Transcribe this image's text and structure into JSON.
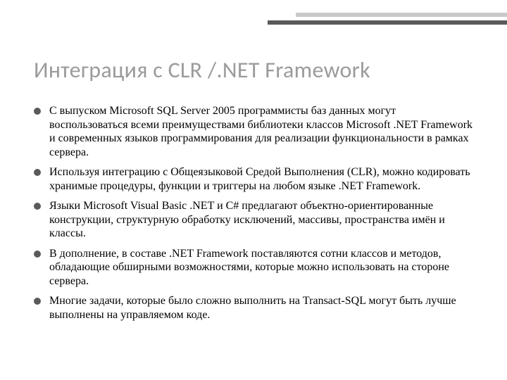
{
  "title": "Интеграция с CLR /.NET Framework",
  "bullets": [
    "С выпуском Microsoft SQL Server 2005 программисты баз данных могут воспользоваться всеми преимуществами библиотеки классов Microsoft .NET Framework и современных языков программирования для реализации функциональности в рамках сервера.",
    "Используя интеграцию с Общеязыковой Средой Выполнения (CLR), можно кодировать хранимые процедуры, функции и триггеры на любом языке .NET Framework.",
    "Языки Microsoft Visual Basic .NET и C# предлагают объектно-ориентированные конструкции, структурную обработку исключений, массивы, пространства имён и классы.",
    "В дополнение, в составе .NET Framework поставляются сотни классов и методов, обладающие обширными возможностями, которые можно использовать на стороне сервера.",
    "Многие задачи, которые было сложно выполнить на Transact-SQL могут быть лучше выполнены на управляемом коде."
  ]
}
